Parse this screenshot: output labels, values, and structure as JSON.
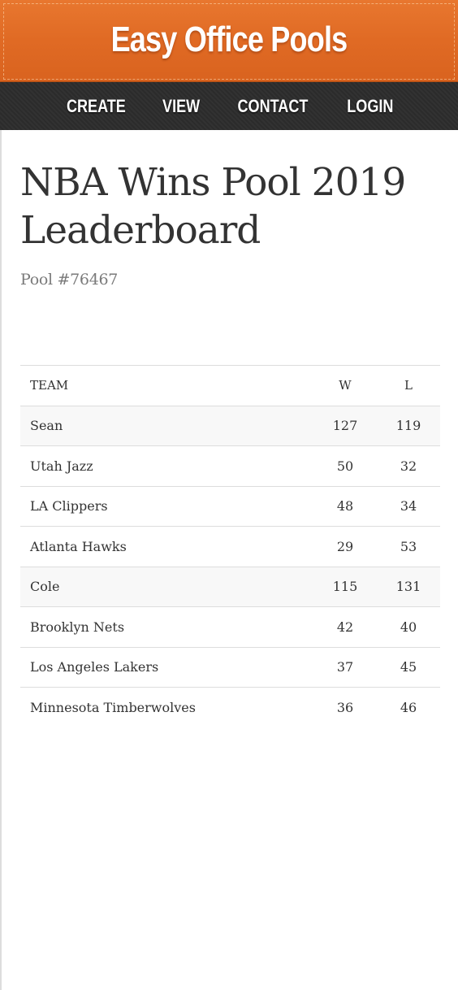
{
  "header": {
    "site_title": "Easy Office Pools",
    "brand_color": "#e06a24"
  },
  "nav": {
    "items": [
      {
        "label": "CREATE"
      },
      {
        "label": "VIEW"
      },
      {
        "label": "CONTACT"
      },
      {
        "label": "LOGIN"
      }
    ]
  },
  "main": {
    "title": "NBA Wins Pool 2019 Leaderboard",
    "pool_id": "Pool #76467"
  },
  "table": {
    "headers": {
      "team": "TEAM",
      "wins": "W",
      "losses": "L"
    },
    "rows": [
      {
        "team": "Sean",
        "w": "127",
        "l": "119",
        "kind": "owner"
      },
      {
        "team": "Utah Jazz",
        "w": "50",
        "l": "32",
        "kind": "team"
      },
      {
        "team": "LA Clippers",
        "w": "48",
        "l": "34",
        "kind": "team"
      },
      {
        "team": "Atlanta Hawks",
        "w": "29",
        "l": "53",
        "kind": "team"
      },
      {
        "team": "Cole",
        "w": "115",
        "l": "131",
        "kind": "owner"
      },
      {
        "team": "Brooklyn Nets",
        "w": "42",
        "l": "40",
        "kind": "team"
      },
      {
        "team": "Los Angeles Lakers",
        "w": "37",
        "l": "45",
        "kind": "team"
      },
      {
        "team": "Minnesota Timberwolves",
        "w": "36",
        "l": "46",
        "kind": "team"
      }
    ]
  }
}
